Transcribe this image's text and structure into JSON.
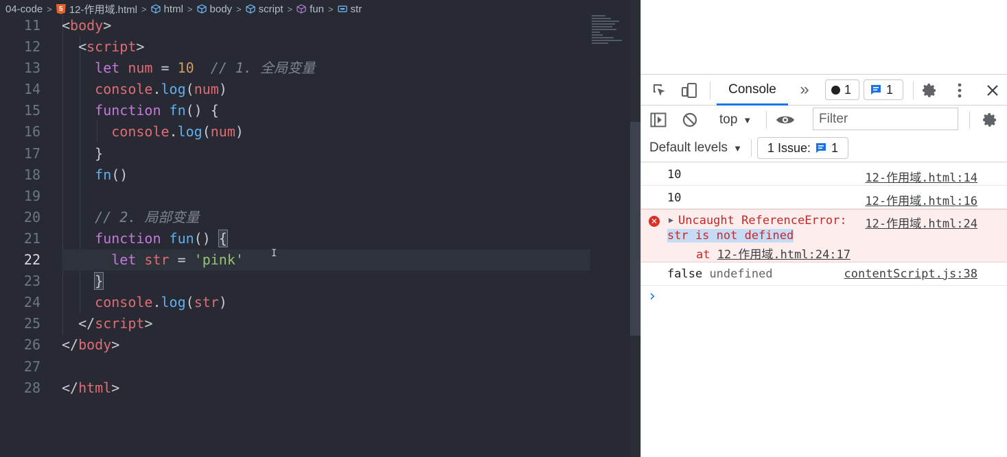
{
  "breadcrumb": {
    "folder": "04-code",
    "file": "12-作用域.html",
    "html": "html",
    "body": "body",
    "script": "script",
    "fun": "fun",
    "str": "str"
  },
  "editor": {
    "line_numbers": [
      "11",
      "12",
      "13",
      "14",
      "15",
      "16",
      "17",
      "18",
      "19",
      "20",
      "21",
      "22",
      "23",
      "24",
      "25",
      "26",
      "27",
      "28"
    ],
    "active_line": "22",
    "code": {
      "l11_tag": "body",
      "l12_tag": "script",
      "l13_let": "let",
      "l13_var": "num",
      "l13_eq": " = ",
      "l13_num": "10",
      "l13_cmt": "// 1. 全局变量",
      "l14_obj": "console",
      "l14_fn": "log",
      "l14_arg": "num",
      "l15_kw": "function",
      "l15_fn": "fn",
      "l15_rest": "() {",
      "l16_obj": "console",
      "l16_fn": "log",
      "l16_arg": "num",
      "l17": "}",
      "l18_fn": "fn",
      "l18_rest": "()",
      "l20_cmt": "// 2. 局部变量",
      "l21_kw": "function",
      "l21_fn": "fun",
      "l21_rest": "() ",
      "l21_brace": "{",
      "l22_let": "let",
      "l22_var": "str",
      "l22_eq": " = ",
      "l22_str": "'pink'",
      "l23_brace": "}",
      "l24_obj": "console",
      "l24_fn": "log",
      "l24_arg": "str",
      "l25_tag": "script",
      "l26_tag": "body",
      "l28_tag": "html"
    }
  },
  "devtools": {
    "tab_console": "Console",
    "errors_count": "1",
    "messages_count": "1",
    "context": "top",
    "filter_placeholder": "Filter",
    "levels": "Default levels",
    "issues_label": "1 Issue:",
    "issues_count": "1",
    "log": [
      {
        "msg": "10",
        "src": "12-作用域.html:14"
      },
      {
        "msg": "10",
        "src": "12-作用域.html:16"
      },
      {
        "msg": "false",
        "msg2": "undefined",
        "src": "contentScript.js:38"
      }
    ],
    "error": {
      "line1": "Uncaught ReferenceError:",
      "src": "12-作用域.html:24",
      "line2": "str is not defined",
      "at": "at ",
      "at_src": "12-作用域.html:24:17"
    },
    "prompt": "›"
  }
}
